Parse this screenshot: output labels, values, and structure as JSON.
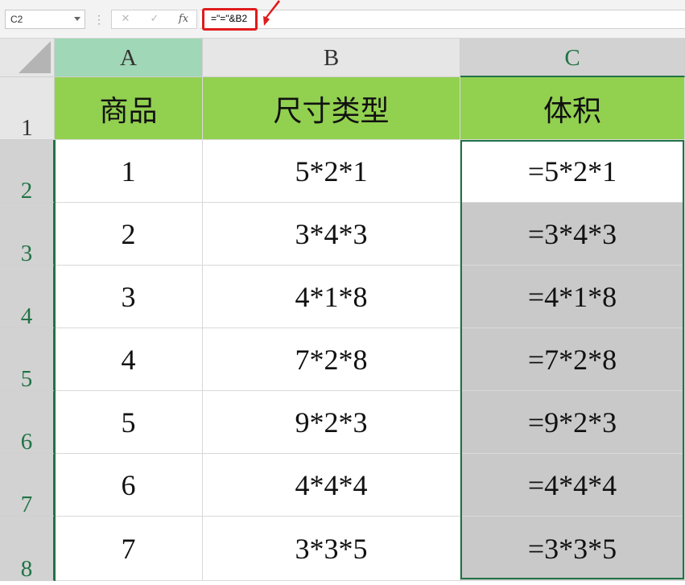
{
  "formula_bar": {
    "name_box": "C2",
    "cancel_icon": "✕",
    "enter_icon": "✓",
    "fx_label": "fx",
    "formula": "=\"=\"&B2"
  },
  "columns": [
    "A",
    "B",
    "C"
  ],
  "rows": [
    "1",
    "2",
    "3",
    "4",
    "5",
    "6",
    "7",
    "8"
  ],
  "table": {
    "headers": [
      "商品",
      "尺寸类型",
      "体积"
    ],
    "data": [
      [
        "1",
        "5*2*1",
        "=5*2*1"
      ],
      [
        "2",
        "3*4*3",
        "=3*4*3"
      ],
      [
        "3",
        "4*1*8",
        "=4*1*8"
      ],
      [
        "4",
        "7*2*8",
        "=7*2*8"
      ],
      [
        "5",
        "9*2*3",
        "=9*2*3"
      ],
      [
        "6",
        "4*4*4",
        "=4*4*4"
      ],
      [
        "7",
        "3*3*5",
        "=3*3*5"
      ]
    ]
  },
  "colors": {
    "header_fill": "#92d050",
    "selection_border": "#217346",
    "annotation": "#e01c1c"
  }
}
